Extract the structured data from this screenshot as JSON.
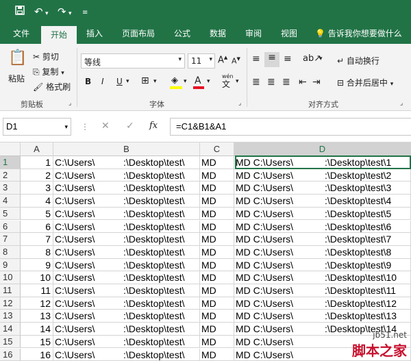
{
  "quick_access": {
    "save_icon": "save-icon",
    "undo_icon": "undo-icon",
    "redo_icon": "redo-icon",
    "customize_icon": "customize-icon"
  },
  "tabs": [
    {
      "label": "文件"
    },
    {
      "label": "开始"
    },
    {
      "label": "插入"
    },
    {
      "label": "页面布局"
    },
    {
      "label": "公式"
    },
    {
      "label": "数据"
    },
    {
      "label": "审阅"
    },
    {
      "label": "视图"
    }
  ],
  "tell_me": "告诉我你想要做什么",
  "clipboard": {
    "paste": "粘贴",
    "cut": "剪切",
    "copy": "复制",
    "format_painter": "格式刷",
    "group_label": "剪贴板"
  },
  "font": {
    "family": "等线",
    "size": "11",
    "bold": "B",
    "italic": "I",
    "underline": "U",
    "group_label": "字体",
    "wen": "wén",
    "wen_char": "文"
  },
  "alignment": {
    "wrap_text": "自动换行",
    "merge_center": "合并后居中",
    "group_label": "对齐方式"
  },
  "formula": {
    "name_box": "D1",
    "cancel": "✕",
    "enter": "✓",
    "fx": "fx",
    "content": "=C1&B1&A1"
  },
  "columns": [
    "A",
    "B",
    "C",
    "D"
  ],
  "rows": [
    {
      "row": "1",
      "a": "1",
      "b1": "C:\\Users\\",
      "b2": ":\\Desktop\\test\\",
      "c": "MD",
      "d1": "MD C:\\Users\\",
      "d2": ":\\Desktop\\test\\1"
    },
    {
      "row": "2",
      "a": "2",
      "b1": "C:\\Users\\",
      "b2": ":\\Desktop\\test\\",
      "c": "MD",
      "d1": "MD C:\\Users\\",
      "d2": ":\\Desktop\\test\\2"
    },
    {
      "row": "3",
      "a": "3",
      "b1": "C:\\Users\\",
      "b2": ":\\Desktop\\test\\",
      "c": "MD",
      "d1": "MD C:\\Users\\",
      "d2": ":\\Desktop\\test\\3"
    },
    {
      "row": "4",
      "a": "4",
      "b1": "C:\\Users\\",
      "b2": ":\\Desktop\\test\\",
      "c": "MD",
      "d1": "MD C:\\Users\\",
      "d2": ":\\Desktop\\test\\4"
    },
    {
      "row": "5",
      "a": "5",
      "b1": "C:\\Users\\",
      "b2": ":\\Desktop\\test\\",
      "c": "MD",
      "d1": "MD C:\\Users\\",
      "d2": ":\\Desktop\\test\\5"
    },
    {
      "row": "6",
      "a": "6",
      "b1": "C:\\Users\\",
      "b2": ":\\Desktop\\test\\",
      "c": "MD",
      "d1": "MD C:\\Users\\",
      "d2": ":\\Desktop\\test\\6"
    },
    {
      "row": "7",
      "a": "7",
      "b1": "C:\\Users\\",
      "b2": ":\\Desktop\\test\\",
      "c": "MD",
      "d1": "MD C:\\Users\\",
      "d2": ":\\Desktop\\test\\7"
    },
    {
      "row": "8",
      "a": "8",
      "b1": "C:\\Users\\",
      "b2": ":\\Desktop\\test\\",
      "c": "MD",
      "d1": "MD C:\\Users\\",
      "d2": ":\\Desktop\\test\\8"
    },
    {
      "row": "9",
      "a": "9",
      "b1": "C:\\Users\\",
      "b2": ":\\Desktop\\test\\",
      "c": "MD",
      "d1": "MD C:\\Users\\",
      "d2": ":\\Desktop\\test\\9"
    },
    {
      "row": "10",
      "a": "10",
      "b1": "C:\\Users\\",
      "b2": ":\\Desktop\\test\\",
      "c": "MD",
      "d1": "MD C:\\Users\\",
      "d2": ":\\Desktop\\test\\10"
    },
    {
      "row": "11",
      "a": "11",
      "b1": "C:\\Users\\",
      "b2": ":\\Desktop\\test\\",
      "c": "MD",
      "d1": "MD C:\\Users\\",
      "d2": ":\\Desktop\\test\\11"
    },
    {
      "row": "12",
      "a": "12",
      "b1": "C:\\Users\\",
      "b2": ":\\Desktop\\test\\",
      "c": "MD",
      "d1": "MD C:\\Users\\",
      "d2": ":\\Desktop\\test\\12"
    },
    {
      "row": "13",
      "a": "13",
      "b1": "C:\\Users\\",
      "b2": ":\\Desktop\\test\\",
      "c": "MD",
      "d1": "MD C:\\Users\\",
      "d2": ":\\Desktop\\test\\13"
    },
    {
      "row": "14",
      "a": "14",
      "b1": "C:\\Users\\",
      "b2": ":\\Desktop\\test\\",
      "c": "MD",
      "d1": "MD C:\\Users\\",
      "d2": ":\\Desktop\\test\\14"
    },
    {
      "row": "15",
      "a": "15",
      "b1": "C:\\Users\\",
      "b2": ":\\Desktop\\test\\",
      "c": "MD",
      "d1": "MD C:\\Users\\",
      "d2": ""
    },
    {
      "row": "16",
      "a": "16",
      "b1": "C:\\Users\\",
      "b2": ":\\Desktop\\test\\",
      "c": "MD",
      "d1": "MD C:\\Users\\",
      "d2": ""
    }
  ],
  "watermark": {
    "site": "jb51.net",
    "name": "脚本之家"
  },
  "colors": {
    "accent": "#217346",
    "selection": "#217346",
    "watermark": "#c8102e"
  }
}
